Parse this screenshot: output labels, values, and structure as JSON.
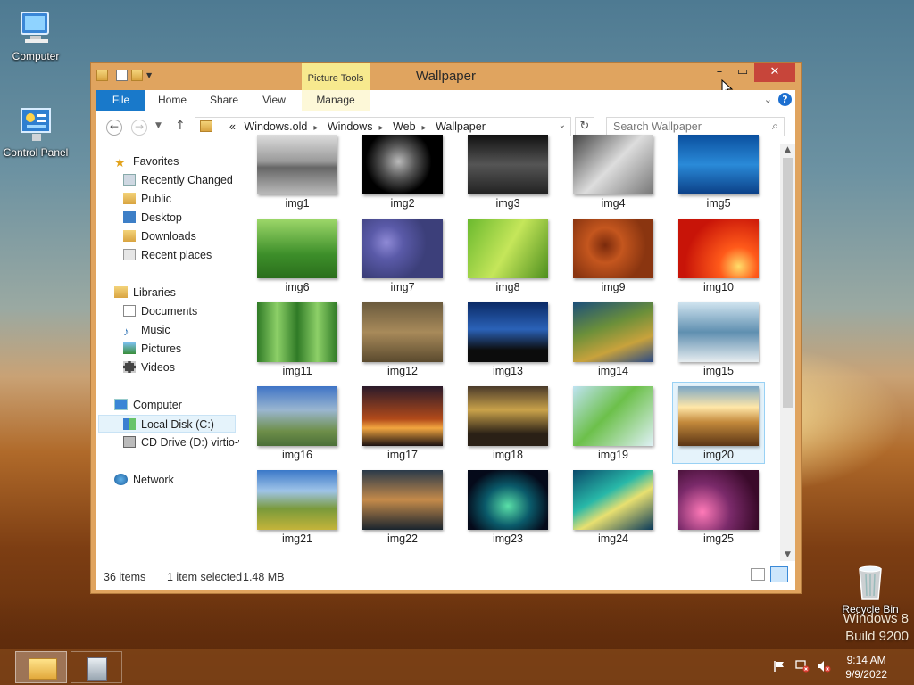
{
  "desktop": {
    "icons": [
      {
        "label": "Computer"
      },
      {
        "label": "Control Panel"
      },
      {
        "label": "Recycle Bin"
      }
    ],
    "watermark": {
      "line1": "Windows 8",
      "line2": "Build 9200"
    }
  },
  "window": {
    "title": "Wallpaper",
    "contextual_tab_group": "Picture Tools",
    "ribbon_tabs": [
      "File",
      "Home",
      "Share",
      "View",
      "Manage"
    ],
    "address": {
      "prefix": "«",
      "crumbs": [
        "Windows.old",
        "Windows",
        "Web",
        "Wallpaper"
      ]
    },
    "search": {
      "placeholder": "Search Wallpaper"
    },
    "nav_pane": {
      "favorites": "Favorites",
      "favorites_items": [
        "Recently Changed",
        "Public",
        "Desktop",
        "Downloads",
        "Recent places"
      ],
      "libraries": "Libraries",
      "libraries_items": [
        "Documents",
        "Music",
        "Pictures",
        "Videos"
      ],
      "computer": "Computer",
      "computer_items": [
        "Local Disk (C:)",
        "CD Drive (D:) virtio-w"
      ],
      "network": "Network"
    },
    "items": [
      {
        "name": "img1"
      },
      {
        "name": "img2"
      },
      {
        "name": "img3"
      },
      {
        "name": "img4"
      },
      {
        "name": "img5"
      },
      {
        "name": "img6"
      },
      {
        "name": "img7"
      },
      {
        "name": "img8"
      },
      {
        "name": "img9"
      },
      {
        "name": "img10"
      },
      {
        "name": "img11"
      },
      {
        "name": "img12"
      },
      {
        "name": "img13"
      },
      {
        "name": "img14"
      },
      {
        "name": "img15"
      },
      {
        "name": "img16"
      },
      {
        "name": "img17"
      },
      {
        "name": "img18"
      },
      {
        "name": "img19"
      },
      {
        "name": "img20"
      },
      {
        "name": "img21"
      },
      {
        "name": "img22"
      },
      {
        "name": "img23"
      },
      {
        "name": "img24"
      },
      {
        "name": "img25"
      }
    ],
    "selected_item": "img20",
    "status": {
      "count": "36 items",
      "selection": "1 item selected",
      "size": "1.48 MB"
    }
  },
  "taskbar": {
    "time": "9:14 AM",
    "date": "9/9/2022"
  },
  "colors": {
    "file_tab": "#1979ca",
    "close_button": "#c7453a",
    "window_frame": "#e0a45f",
    "selection": "#e5f3fb",
    "contextual_tab": "#f7e98e"
  }
}
